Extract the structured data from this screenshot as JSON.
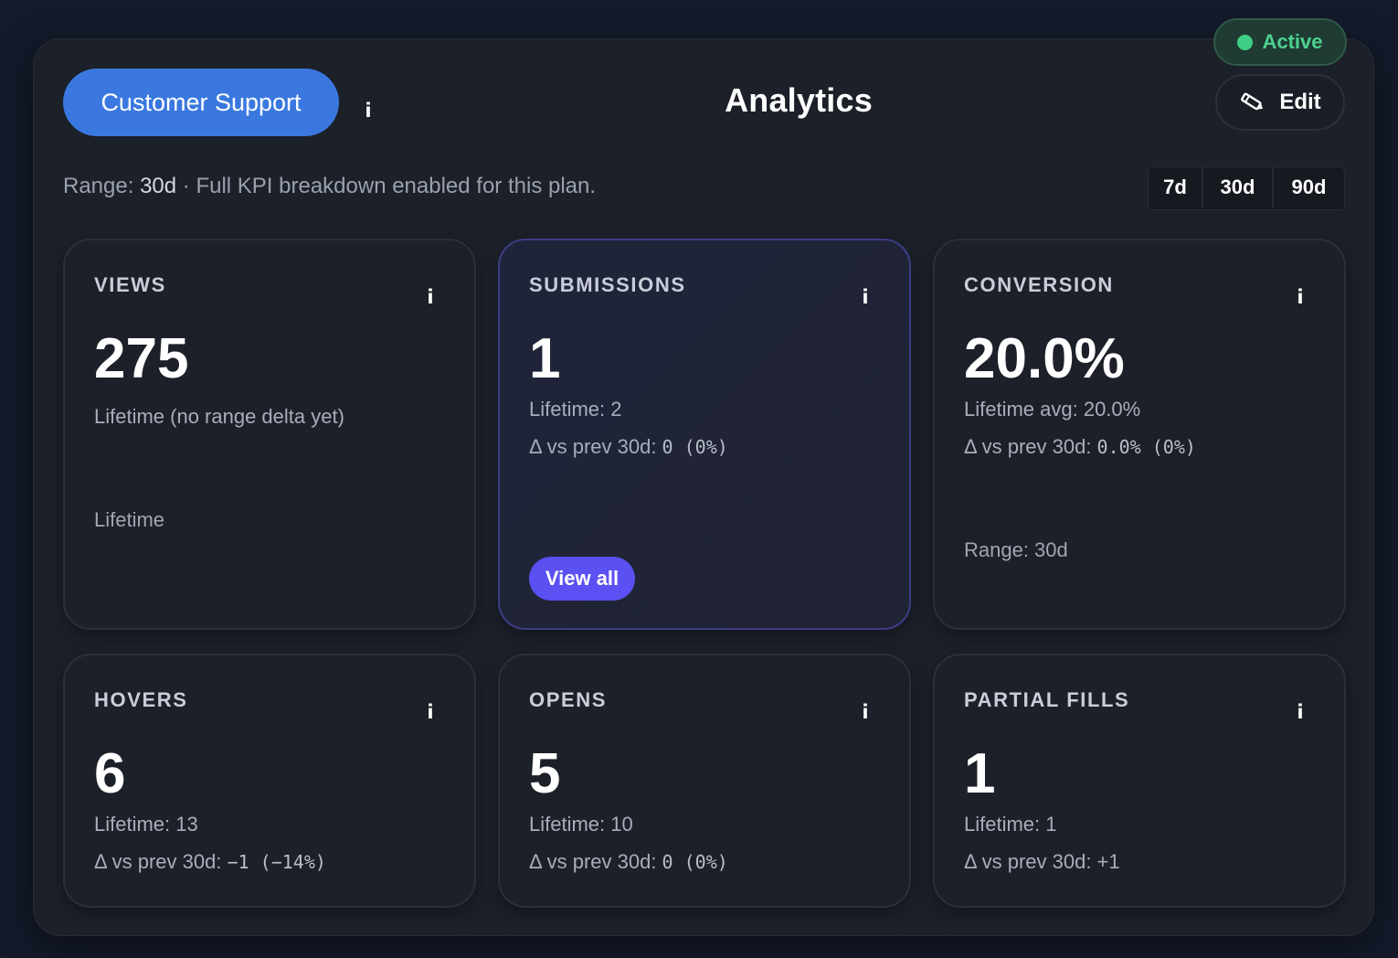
{
  "header": {
    "workspace_button": "Customer Support",
    "title": "Analytics",
    "status_label": "Active",
    "edit_label": "Edit"
  },
  "range": {
    "prefix": "Range: ",
    "value": "30d",
    "note": " · Full KPI breakdown enabled for this plan.",
    "options": [
      "7d",
      "30d",
      "90d"
    ]
  },
  "cards": [
    {
      "label": "VIEWS",
      "value": "275",
      "line1": "Lifetime (no range delta yet)",
      "footer": "Lifetime"
    },
    {
      "label": "SUBMISSIONS",
      "value": "1",
      "line1": "Lifetime: 2",
      "delta_prefix": "Δ vs prev 30d: ",
      "delta_value": "0 (0%)",
      "action": "View all"
    },
    {
      "label": "CONVERSION",
      "value": "20.0%",
      "line1": "Lifetime avg: 20.0%",
      "delta_prefix": "Δ vs prev 30d: ",
      "delta_value": "0.0% (0%)",
      "footer": "Range: 30d"
    },
    {
      "label": "HOVERS",
      "value": "6",
      "line1": "Lifetime: 13",
      "delta_prefix": "Δ vs prev 30d: ",
      "delta_value": "−1 (−14%)"
    },
    {
      "label": "OPENS",
      "value": "5",
      "line1": "Lifetime: 10",
      "delta_prefix": "Δ vs prev 30d: ",
      "delta_value": "0 (0%)"
    },
    {
      "label": "PARTIAL FILLS",
      "value": "1",
      "line1": "Lifetime: 1",
      "delta_prefix": "Δ vs prev 30d: ",
      "delta_value": "+1"
    }
  ],
  "icons": {
    "info": "info-icon",
    "edit": "pencil-icon",
    "status": "status-dot-icon"
  },
  "colors": {
    "primary": "#3a78e0",
    "accent": "#5b50f2",
    "success": "#3fcf84",
    "panel": "#1c2029",
    "background": "#141a2a"
  }
}
